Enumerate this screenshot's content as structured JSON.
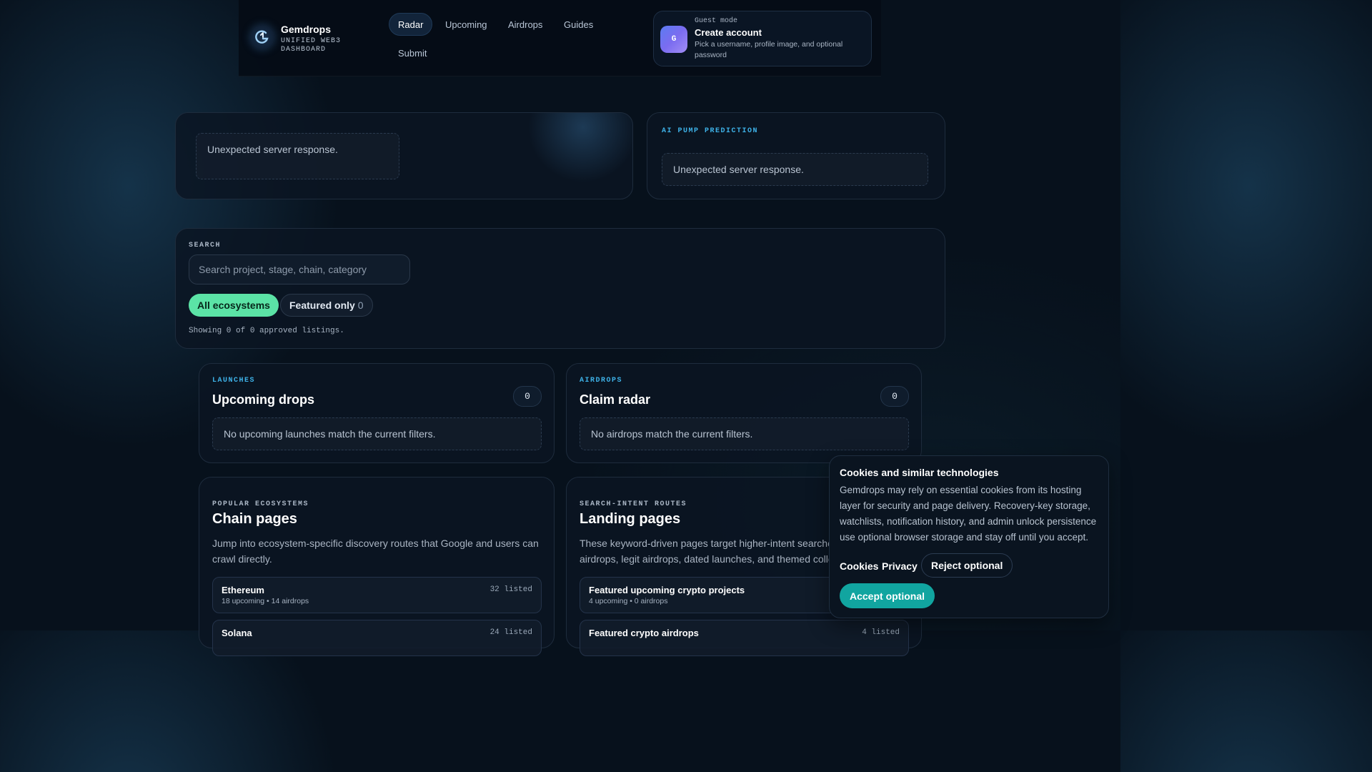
{
  "brand": {
    "name": "Gemdrops",
    "subtitle_line1": "UNIFIED WEB3",
    "subtitle_line2": "DASHBOARD"
  },
  "nav": [
    "Radar",
    "Upcoming",
    "Airdrops",
    "Guides",
    "Submit"
  ],
  "account": {
    "guest_label": "Guest mode",
    "avatar_initial": "G",
    "title": "Create account",
    "description": "Pick a username, profile image, and optional password"
  },
  "hero": {
    "error": "Unexpected server response."
  },
  "prediction": {
    "eyebrow": "AI PUMP PREDICTION",
    "error": "Unexpected server response."
  },
  "search": {
    "label": "SEARCH",
    "placeholder": "Search project, stage, chain, category",
    "chip_all": "All ecosystems",
    "chip_featured": "Featured only",
    "chip_featured_count": "0",
    "showing": "Showing 0 of 0 approved listings."
  },
  "launches": {
    "eyebrow": "LAUNCHES",
    "title": "Upcoming drops",
    "count": "0",
    "empty": "No upcoming launches match the current filters."
  },
  "airdrops": {
    "eyebrow": "AIRDROPS",
    "title": "Claim radar",
    "count": "0",
    "empty": "No airdrops match the current filters."
  },
  "chains": {
    "eyebrow": "POPULAR ECOSYSTEMS",
    "title": "Chain pages",
    "description": "Jump into ecosystem-specific discovery routes that Google and users can crawl directly.",
    "items": [
      {
        "name": "Ethereum",
        "stats": "18 upcoming • 14 airdrops",
        "count": "32 listed"
      },
      {
        "name": "Solana",
        "stats": "",
        "count": "24 listed"
      }
    ]
  },
  "landing": {
    "eyebrow": "SEARCH-INTENT ROUTES",
    "title": "Landing pages",
    "description": "These keyword-driven pages target higher-intent searches such as airdrops, legit airdrops, dated launches, and themed collections.",
    "items": [
      {
        "name": "Featured upcoming crypto projects",
        "stats": "4 upcoming • 0 airdrops",
        "count": ""
      },
      {
        "name": "Featured crypto airdrops",
        "stats": "",
        "count": "4 listed"
      }
    ]
  },
  "cookie": {
    "title": "Cookies and similar technologies",
    "text": "Gemdrops may rely on essential cookies from its hosting layer for security and page delivery. Recovery-key storage, watchlists, notification history, and admin unlock persistence use optional browser storage and stay off until you accept.",
    "link_cookies": "Cookies",
    "link_privacy": "Privacy",
    "reject": "Reject optional",
    "accept": "Accept optional"
  },
  "colors": {
    "accent_green": "#5be3a6",
    "accent_teal": "#11a5a0",
    "eyebrow_blue": "#3eb2e8",
    "background": "#07111c"
  }
}
